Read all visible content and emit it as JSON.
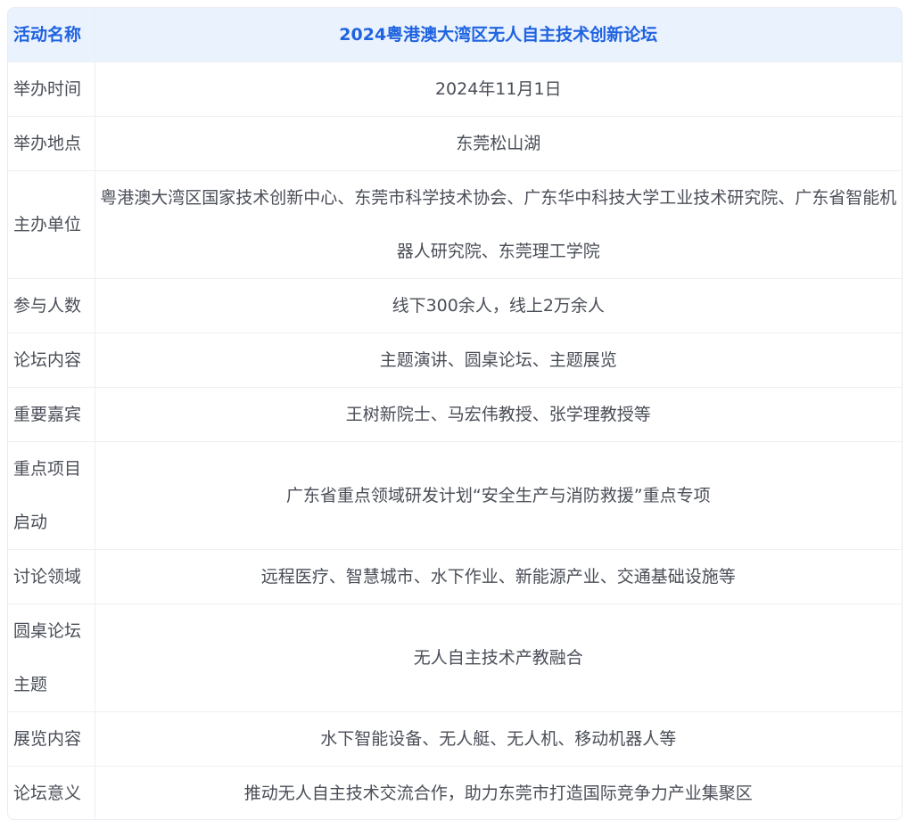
{
  "header": {
    "label": "活动名称",
    "value": "2024粤港澳大湾区无人自主技术创新论坛"
  },
  "rows": [
    {
      "label": "举办时间",
      "value": "2024年11月1日"
    },
    {
      "label": "举办地点",
      "value": "东莞松山湖"
    },
    {
      "label": "主办单位",
      "value": "粤港澳大湾区国家技术创新中心、东莞市科学技术协会、广东华中科技大学工业技术研究院、广东省智能机器人研究院、东莞理工学院"
    },
    {
      "label": "参与人数",
      "value": "线下300余人，线上2万余人"
    },
    {
      "label": "论坛内容",
      "value": "主题演讲、圆桌论坛、主题展览"
    },
    {
      "label": "重要嘉宾",
      "value": "王树新院士、马宏伟教授、张学理教授等"
    },
    {
      "label": "重点项目启动",
      "value": "广东省重点领域研发计划“安全生产与消防救援”重点专项"
    },
    {
      "label": "讨论领域",
      "value": "远程医疗、智慧城市、水下作业、新能源产业、交通基础设施等"
    },
    {
      "label": "圆桌论坛主题",
      "value": "无人自主技术产教融合"
    },
    {
      "label": "展览内容",
      "value": "水下智能设备、无人艇、无人机、移动机器人等"
    },
    {
      "label": "论坛意义",
      "value": "推动无人自主技术交流合作，助力东莞市打造国际竞争力产业集聚区"
    }
  ],
  "colors": {
    "header_bg": "#eaf2fe",
    "header_text": "#1f63e0",
    "body_text": "#4a4e57",
    "border": "#eceff4"
  }
}
